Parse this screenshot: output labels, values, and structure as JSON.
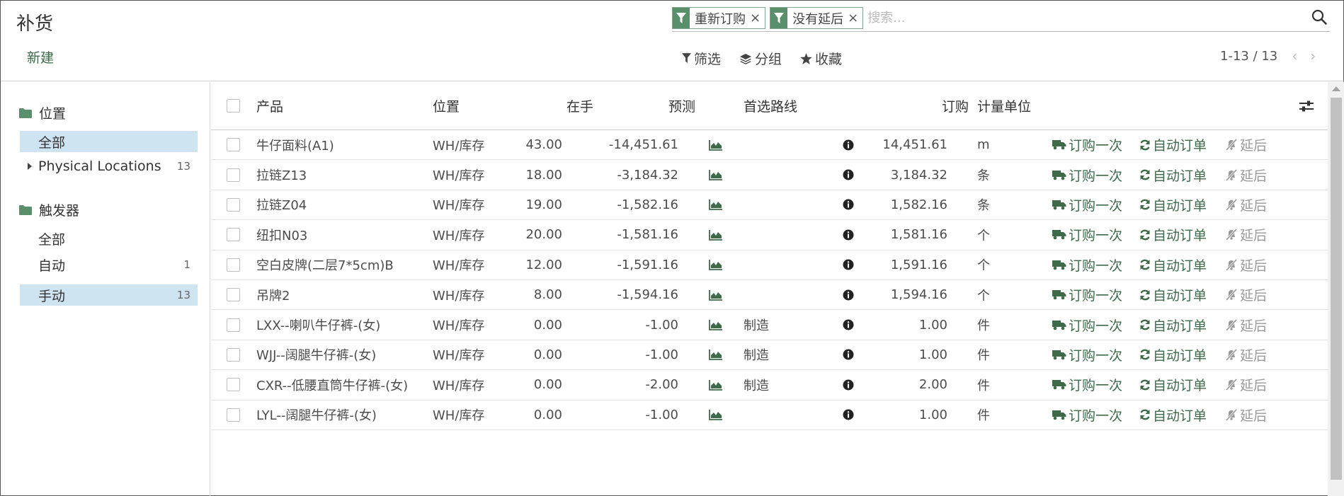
{
  "page": {
    "title": "补货",
    "new_label": "新建"
  },
  "search": {
    "facets": [
      {
        "label": "重新订购"
      },
      {
        "label": "没有延后"
      }
    ],
    "placeholder": "搜索..."
  },
  "toolbar": {
    "filter_label": "筛选",
    "group_label": "分组",
    "favorite_label": "收藏"
  },
  "pager": {
    "range": "1-13 / 13"
  },
  "sidebar": {
    "sections": [
      {
        "title": "位置",
        "items": [
          {
            "label": "全部",
            "count": "",
            "active": true
          },
          {
            "label": "Physical Locations",
            "count": "13",
            "active": false,
            "expandable": true
          }
        ]
      },
      {
        "title": "触发器",
        "items": [
          {
            "label": "全部",
            "count": "",
            "active": false
          },
          {
            "label": "自动",
            "count": "1",
            "active": false
          },
          {
            "label": "手动",
            "count": "13",
            "active": true
          }
        ]
      }
    ]
  },
  "table": {
    "headers": {
      "product": "产品",
      "location": "位置",
      "on_hand": "在手",
      "forecast": "预测",
      "route": "首选路线",
      "order": "订购",
      "uom": "计量单位"
    },
    "actions": {
      "order_once": "订购一次",
      "auto_order": "自动订单",
      "snooze": "延后"
    },
    "rows": [
      {
        "product": "牛仔面料(A1)",
        "location": "WH/库存",
        "on_hand": "43.00",
        "forecast": "-14,451.61",
        "route": "",
        "order": "14,451.61",
        "uom": "m"
      },
      {
        "product": "拉链Z13",
        "location": "WH/库存",
        "on_hand": "18.00",
        "forecast": "-3,184.32",
        "route": "",
        "order": "3,184.32",
        "uom": "条"
      },
      {
        "product": "拉链Z04",
        "location": "WH/库存",
        "on_hand": "19.00",
        "forecast": "-1,582.16",
        "route": "",
        "order": "1,582.16",
        "uom": "条"
      },
      {
        "product": "纽扣N03",
        "location": "WH/库存",
        "on_hand": "20.00",
        "forecast": "-1,581.16",
        "route": "",
        "order": "1,581.16",
        "uom": "个"
      },
      {
        "product": "空白皮牌(二层7*5cm)B",
        "location": "WH/库存",
        "on_hand": "12.00",
        "forecast": "-1,591.16",
        "route": "",
        "order": "1,591.16",
        "uom": "个"
      },
      {
        "product": "吊牌2",
        "location": "WH/库存",
        "on_hand": "8.00",
        "forecast": "-1,594.16",
        "route": "",
        "order": "1,594.16",
        "uom": "个"
      },
      {
        "product": "LXX--喇叭牛仔裤-(女)",
        "location": "WH/库存",
        "on_hand": "0.00",
        "forecast": "-1.00",
        "route": "制造",
        "order": "1.00",
        "uom": "件"
      },
      {
        "product": "WJJ--阔腿牛仔裤-(女)",
        "location": "WH/库存",
        "on_hand": "0.00",
        "forecast": "-1.00",
        "route": "制造",
        "order": "1.00",
        "uom": "件"
      },
      {
        "product": "CXR--低腰直筒牛仔裤-(女)",
        "location": "WH/库存",
        "on_hand": "0.00",
        "forecast": "-2.00",
        "route": "制造",
        "order": "2.00",
        "uom": "件"
      },
      {
        "product": "LYL--阔腿牛仔裤-(女)",
        "location": "WH/库存",
        "on_hand": "0.00",
        "forecast": "-1.00",
        "route": "",
        "order": "1.00",
        "uom": "件"
      }
    ]
  },
  "colors": {
    "accent": "#3e6a4a",
    "facet": "#5a8f6b",
    "active_bg": "#cfe4f1"
  }
}
